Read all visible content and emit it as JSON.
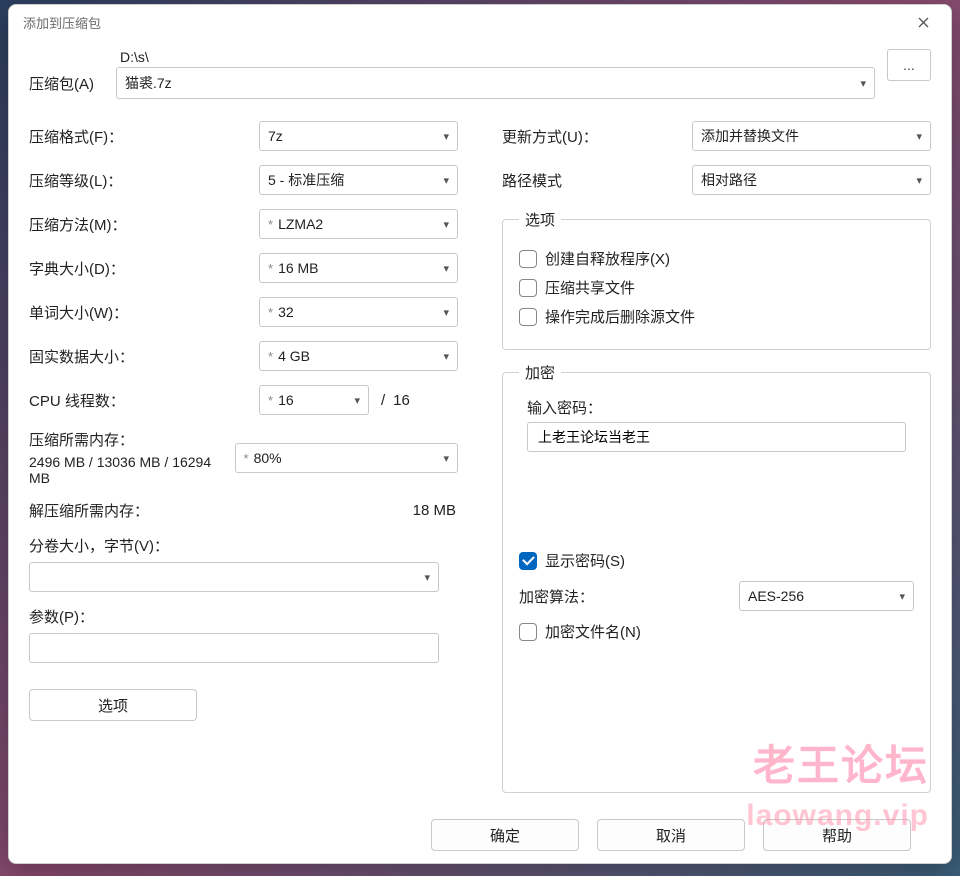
{
  "title": "添加到压缩包",
  "archive": {
    "label": "压缩包(A)",
    "path": "D:\\s\\",
    "filename": "猫裘.7z",
    "browse": "..."
  },
  "left": {
    "format": {
      "label": "压缩格式(F)：",
      "value": "7z"
    },
    "level": {
      "label": "压缩等级(L)：",
      "value": "5 - 标准压缩"
    },
    "method": {
      "label": "压缩方法(M)：",
      "value": "LZMA2"
    },
    "dict": {
      "label": "字典大小(D)：",
      "value": "16 MB"
    },
    "word": {
      "label": "单词大小(W)：",
      "value": "32"
    },
    "solid": {
      "label": "固实数据大小：",
      "value": "4 GB"
    },
    "threads": {
      "label": "CPU 线程数：",
      "value": "16",
      "slash": "/",
      "max": "16"
    },
    "memcomp": {
      "label1": "压缩所需内存：",
      "label2": "2496 MB / 13036 MB / 16294 MB",
      "pct": "80%"
    },
    "memdecomp": {
      "label": "解压缩所需内存：",
      "value": "18 MB"
    },
    "split": {
      "label": "分卷大小，字节(V)：",
      "value": ""
    },
    "params": {
      "label": "参数(P)：",
      "value": ""
    },
    "options_btn": "选项"
  },
  "right": {
    "update": {
      "label": "更新方式(U)：",
      "value": "添加并替换文件"
    },
    "pathmode": {
      "label": "路径模式",
      "value": "相对路径"
    },
    "opts_group": "选项",
    "opt_sfx": "创建自释放程序(X)",
    "opt_shared": "压缩共享文件",
    "opt_delete": "操作完成后删除源文件",
    "enc_group": "加密",
    "pwd_label": "输入密码：",
    "pwd_value": "上老王论坛当老王",
    "show_pwd": "显示密码(S)",
    "enc_method_label": "加密算法：",
    "enc_method_value": "AES-256",
    "enc_names": "加密文件名(N)"
  },
  "footer": {
    "ok": "确定",
    "cancel": "取消",
    "help": "帮助"
  },
  "watermark": {
    "line1": "老王论坛",
    "line2": "laowang.vip"
  }
}
